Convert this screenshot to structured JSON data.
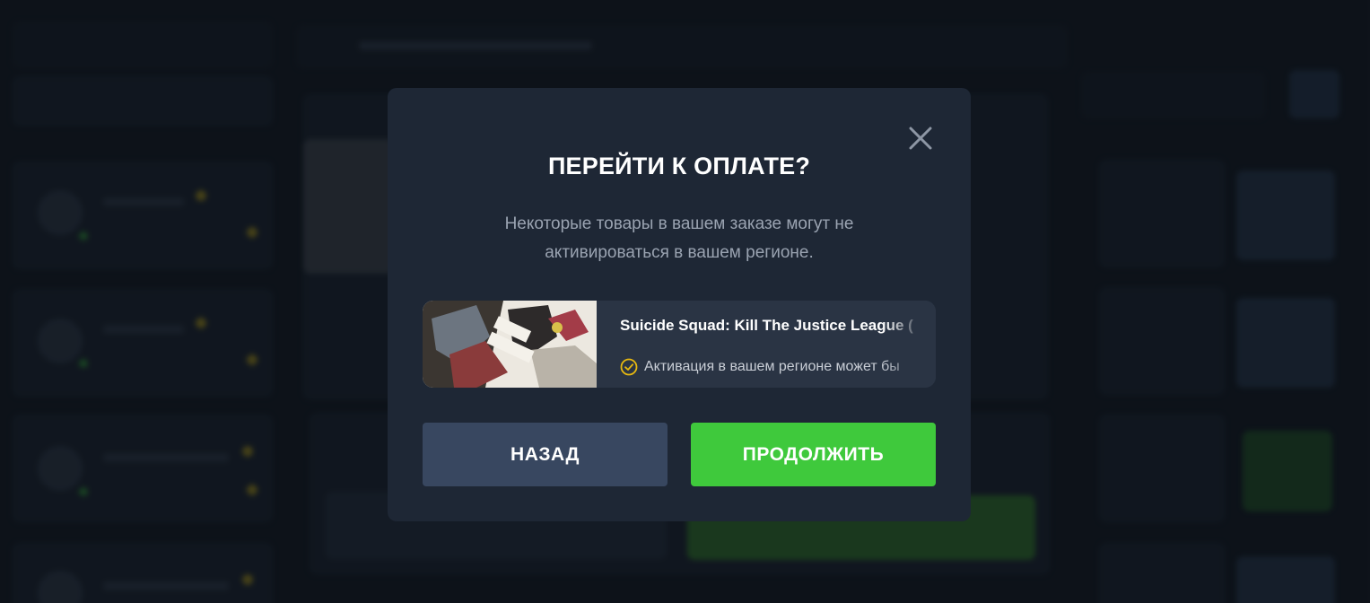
{
  "modal": {
    "title": "ПЕРЕЙТИ К ОПЛАТЕ?",
    "subtitle": "Некоторые товары в вашем заказе могут не активироваться в вашем регионе.",
    "close_icon": "close-icon",
    "item": {
      "name": "Suicide Squad: Kill The Justice League (",
      "status_icon": "check-circle-icon",
      "status_text": "Активация в вашем регионе может бы",
      "status_icon_color": "#e8b90f"
    },
    "buttons": {
      "back_label": "НАЗАД",
      "continue_label": "ПРОДОЛЖИТЬ"
    }
  },
  "colors": {
    "modal_bg": "#1e2735",
    "item_bg": "#2a3444",
    "back_button": "#384760",
    "continue_button": "#3fc93c"
  }
}
